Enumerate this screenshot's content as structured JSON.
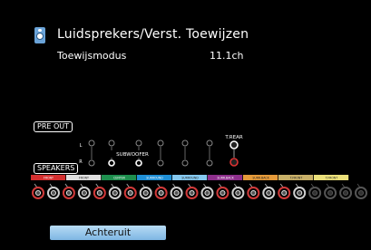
{
  "header": {
    "title": "Luidsprekers/Verst. Toewijzen",
    "icon": "speaker-icon"
  },
  "mode": {
    "label": "Toewijsmodus",
    "value": "11.1ch"
  },
  "pre_out": {
    "label": "PRE OUT",
    "side_labels": [
      "L",
      "R"
    ],
    "subwoofer_label": "SUBWOOFER",
    "trear_label": "T.REAR"
  },
  "speakers": {
    "label": "SPEAKERS",
    "channels": [
      {
        "label": "FRONT",
        "color": "#d32f2f",
        "active": true
      },
      {
        "label": "FRONT",
        "color": "#e0e0e0",
        "active": true
      },
      {
        "label": "CENTER",
        "color": "#1e8f4e",
        "active": true
      },
      {
        "label": "SURROUND",
        "color": "#1f8fd6",
        "active": true
      },
      {
        "label": "SURROUND",
        "color": "#86c9f0",
        "active": true
      },
      {
        "label": "SURR.BACK",
        "color": "#8e2f8c",
        "active": true
      },
      {
        "label": "SURR.BACK",
        "color": "#e59a3a",
        "active": true
      },
      {
        "label": "T.FRONT",
        "color": "#c8b068",
        "active": true
      },
      {
        "label": "T.FRONT",
        "color": "#ebe07a",
        "active": true
      }
    ]
  },
  "footer": {
    "back_label": "Achteruit"
  },
  "colors": {
    "accent": "#7eb6e3",
    "background": "#000000"
  }
}
